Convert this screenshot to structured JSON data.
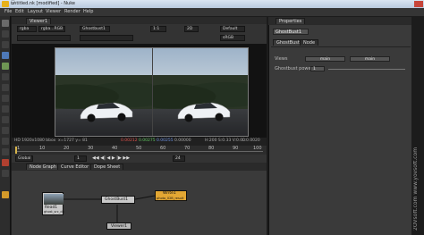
{
  "window": {
    "title": "untitled.nk [modified] - Nuke"
  },
  "menu": [
    "File",
    "Edit",
    "Layout",
    "Viewer",
    "Render",
    "Help"
  ],
  "viewer": {
    "tab": "Viewer1",
    "channels": "rgba",
    "layer": "rgba...RGB",
    "input_a": "Ghostbust1",
    "zoom": "1:1",
    "view": "2D",
    "lut": "Default",
    "proxy": "sRGB",
    "info": {
      "format": "HD 1920x1080 bbox",
      "coords": "x=1727 y= 81",
      "red": "0.00212",
      "green": "0.00275",
      "blue": "0.00255",
      "alpha": "0.00000",
      "hsv": "H:200 S:0.33 V:0.00",
      "lum": "L:0.0020"
    }
  },
  "timeline": {
    "ticks": [
      "1",
      "10",
      "20",
      "30",
      "40",
      "50",
      "60",
      "70",
      "80",
      "90",
      "100"
    ],
    "frame": "1",
    "fps": "24",
    "range": "Global"
  },
  "node_graph": {
    "tabs": [
      "Node Graph",
      "Curve Editor",
      "Dope Sheet"
    ],
    "nodes": {
      "read": {
        "name": "Read1",
        "sub": "ghost_src_dn"
      },
      "ghost": {
        "name": "GhostBust1"
      },
      "write": {
        "name": "Write1",
        "sub": "photo_02B_result"
      },
      "viewer": {
        "name": "Viewer1"
      }
    }
  },
  "properties": {
    "title": "Properties",
    "node_name": "GhostBust1",
    "tabs": [
      "GhostBust",
      "Node"
    ],
    "views_label": "Views",
    "views": [
      "main",
      "main"
    ],
    "power_label": "Ghostbust power",
    "power_value": "1"
  },
  "watermark": "2OVsoft.com  www.yovsoft.com"
}
